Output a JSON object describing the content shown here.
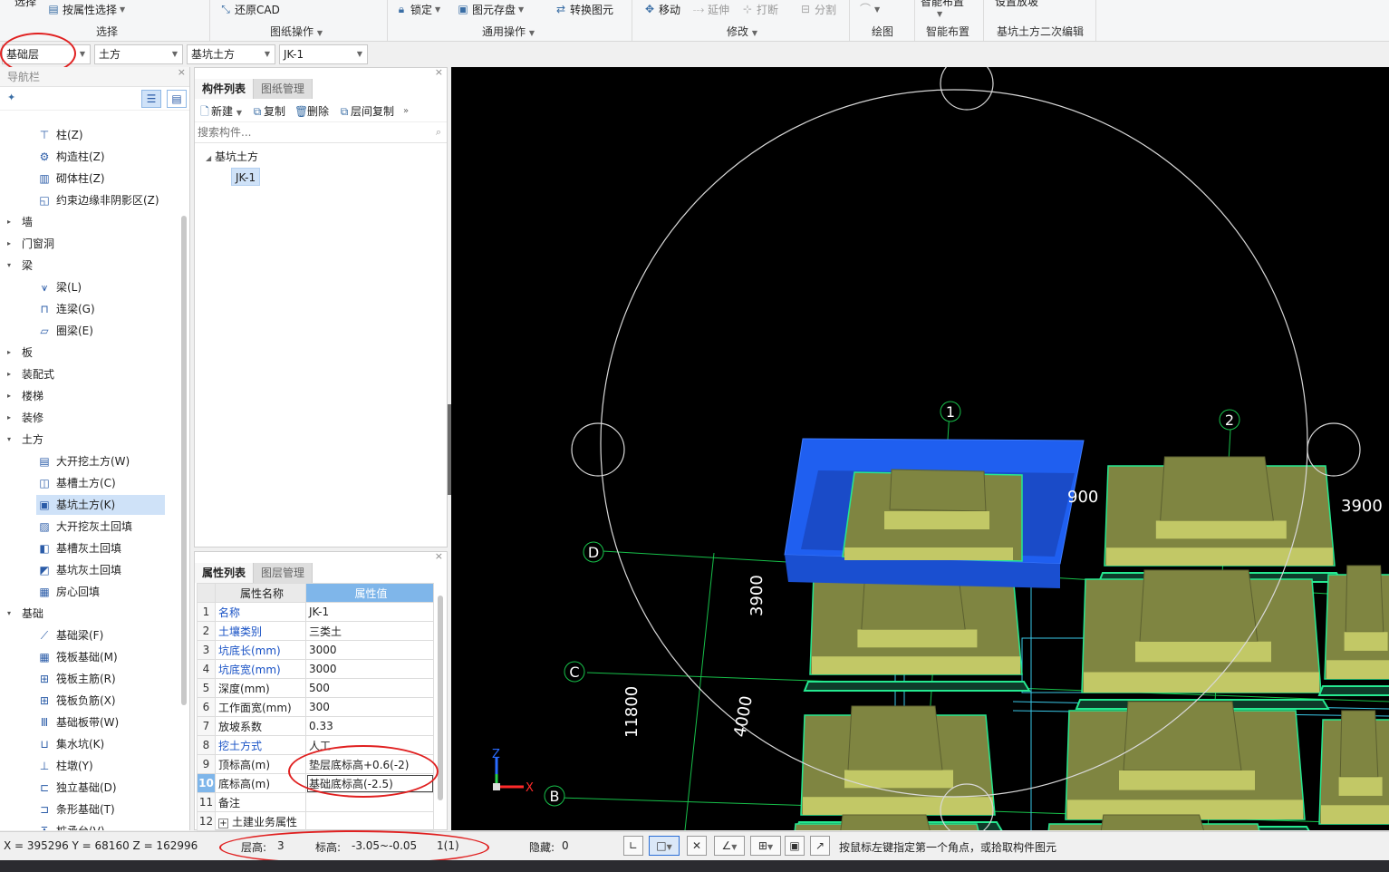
{
  "ribbon": {
    "groups": {
      "select": {
        "label": "选择",
        "btn_prop_select": "按属性选择",
        "btn_partial": "选择"
      },
      "drawing": {
        "label": "图纸操作",
        "btn_restore_cad": "还原CAD"
      },
      "common": {
        "label": "通用操作",
        "btn_lock": "锁定",
        "btn_save_element": "图元存盘",
        "btn_convert": "转换图元"
      },
      "modify": {
        "label": "修改",
        "btn_move": "移动",
        "btn_extend": "延伸",
        "btn_break": "打断",
        "btn_split": "分割"
      },
      "draw": {
        "label": "绘图"
      },
      "smart": {
        "label": "智能布置",
        "btn_partial": "智能布置"
      },
      "pit_edit": {
        "label": "基坑土方二次编辑",
        "btn_partial": "设置放坡"
      }
    }
  },
  "dropdowns": {
    "floor": "基础层",
    "category": "土方",
    "type": "基坑土方",
    "component": "JK-1"
  },
  "nav": {
    "title": "导航栏",
    "items": [
      {
        "kind": "item",
        "label": "柱(Z)",
        "icon": "column-icon"
      },
      {
        "kind": "item",
        "label": "构造柱(Z)",
        "icon": "construct-column-icon"
      },
      {
        "kind": "item",
        "label": "砌体柱(Z)",
        "icon": "masonry-column-icon"
      },
      {
        "kind": "item",
        "label": "约束边缘非阴影区(Z)",
        "icon": "edge-zone-icon"
      },
      {
        "kind": "cat",
        "label": "墙",
        "expanded": false
      },
      {
        "kind": "cat",
        "label": "门窗洞",
        "expanded": false
      },
      {
        "kind": "cat",
        "label": "梁",
        "expanded": true
      },
      {
        "kind": "item",
        "label": "梁(L)",
        "icon": "beam-icon"
      },
      {
        "kind": "item",
        "label": "连梁(G)",
        "icon": "link-beam-icon"
      },
      {
        "kind": "item",
        "label": "圈梁(E)",
        "icon": "ring-beam-icon"
      },
      {
        "kind": "cat",
        "label": "板",
        "expanded": false
      },
      {
        "kind": "cat",
        "label": "装配式",
        "expanded": false
      },
      {
        "kind": "cat",
        "label": "楼梯",
        "expanded": false
      },
      {
        "kind": "cat",
        "label": "装修",
        "expanded": false
      },
      {
        "kind": "cat",
        "label": "土方",
        "expanded": true
      },
      {
        "kind": "item",
        "label": "大开挖土方(W)",
        "icon": "excavation-icon"
      },
      {
        "kind": "item",
        "label": "基槽土方(C)",
        "icon": "trench-icon"
      },
      {
        "kind": "item",
        "label": "基坑土方(K)",
        "icon": "pit-icon",
        "selected": true
      },
      {
        "kind": "item",
        "label": "大开挖灰土回填",
        "icon": "backfill-icon"
      },
      {
        "kind": "item",
        "label": "基槽灰土回填",
        "icon": "trench-backfill-icon"
      },
      {
        "kind": "item",
        "label": "基坑灰土回填",
        "icon": "pit-backfill-icon"
      },
      {
        "kind": "item",
        "label": "房心回填",
        "icon": "room-backfill-icon"
      },
      {
        "kind": "cat",
        "label": "基础",
        "expanded": true
      },
      {
        "kind": "item",
        "label": "基础梁(F)",
        "icon": "foundation-beam-icon"
      },
      {
        "kind": "item",
        "label": "筏板基础(M)",
        "icon": "raft-icon"
      },
      {
        "kind": "item",
        "label": "筏板主筋(R)",
        "icon": "raft-main-rebar-icon"
      },
      {
        "kind": "item",
        "label": "筏板负筋(X)",
        "icon": "raft-neg-rebar-icon"
      },
      {
        "kind": "item",
        "label": "基础板带(W)",
        "icon": "slab-strip-icon"
      },
      {
        "kind": "item",
        "label": "集水坑(K)",
        "icon": "sump-icon"
      },
      {
        "kind": "item",
        "label": "柱墩(Y)",
        "icon": "pier-icon"
      },
      {
        "kind": "item",
        "label": "独立基础(D)",
        "icon": "isolated-footing-icon"
      },
      {
        "kind": "item",
        "label": "条形基础(T)",
        "icon": "strip-footing-icon"
      },
      {
        "kind": "item",
        "label": "桩承台(V)",
        "icon": "pile-cap-icon"
      }
    ]
  },
  "component_panel": {
    "tabs": [
      "构件列表",
      "图纸管理"
    ],
    "toolbar": {
      "new": "新建",
      "copy": "复制",
      "delete": "删除",
      "floor_copy": "层间复制"
    },
    "search_placeholder": "搜索构件...",
    "tree": {
      "group": "基坑土方",
      "items": [
        "JK-1"
      ]
    }
  },
  "property_panel": {
    "tabs": [
      "属性列表",
      "图层管理"
    ],
    "headers": [
      "属性名称",
      "属性值"
    ],
    "rows": [
      {
        "n": "1",
        "name": "名称",
        "value": "JK-1",
        "blue": true
      },
      {
        "n": "2",
        "name": "土壤类别",
        "value": "三类土",
        "blue": true
      },
      {
        "n": "3",
        "name": "坑底长(mm)",
        "value": "3000",
        "blue": true
      },
      {
        "n": "4",
        "name": "坑底宽(mm)",
        "value": "3000",
        "blue": true
      },
      {
        "n": "5",
        "name": "深度(mm)",
        "value": "500",
        "blue": false
      },
      {
        "n": "6",
        "name": "工作面宽(mm)",
        "value": "300",
        "blue": false
      },
      {
        "n": "7",
        "name": "放坡系数",
        "value": "0.33",
        "blue": false
      },
      {
        "n": "8",
        "name": "挖土方式",
        "value": "人工",
        "blue": true
      },
      {
        "n": "9",
        "name": "顶标高(m)",
        "value": "垫层底标高+0.6(-2)",
        "blue": false
      },
      {
        "n": "10",
        "name": "底标高(m)",
        "value": "基础底标高(-2.5)",
        "blue": false
      },
      {
        "n": "11",
        "name": "备注",
        "value": "",
        "blue": false
      },
      {
        "n": "12",
        "name": "土建业务属性",
        "value": "",
        "blue": false
      }
    ]
  },
  "viewport": {
    "axis_labels": [
      "1",
      "2",
      "D",
      "C",
      "B"
    ],
    "dims": [
      "3900",
      "3900",
      "900",
      "11800",
      "4000"
    ],
    "axis_gizmo": {
      "z": "Z",
      "x": "X"
    },
    "colors": {
      "grid": "#17c04a",
      "pit": "#1f5ff0",
      "footing": "#7f8541",
      "footing_top": "#c2c866",
      "edge": "#25e890"
    }
  },
  "status": {
    "coords": "X = 395296 Y = 68160 Z = 162996",
    "floor_height_label": "层高:",
    "floor_height": "3",
    "elevation_label": "标高:",
    "elevation": "-3.05~-0.05",
    "floor_index": "1(1)",
    "hidden_label": "隐藏:",
    "hidden": "0",
    "hint": "按鼠标左键指定第一个角点，或拾取构件图元"
  }
}
